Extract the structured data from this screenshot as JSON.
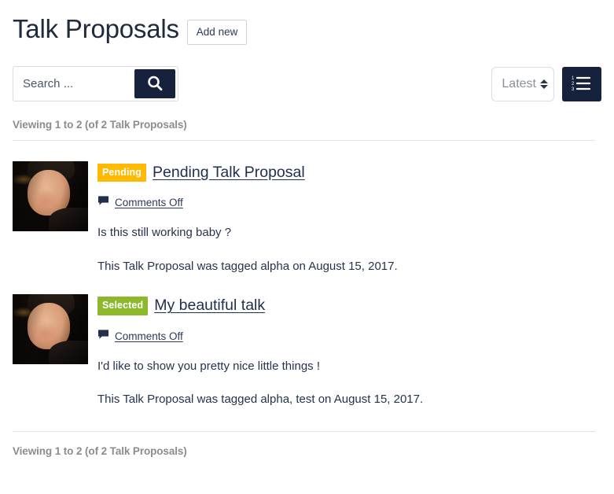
{
  "header": {
    "title": "Talk Proposals",
    "add_new_label": "Add new"
  },
  "toolbar": {
    "search_placeholder": "Search ...",
    "search_value": "",
    "search_icon": "search-icon",
    "sort_selected": "Latest",
    "sort_options": [
      "Latest"
    ],
    "list_view_icon": "ordered-list-icon"
  },
  "results": {
    "viewing_top": "Viewing 1 to 2 (of 2 Talk Proposals)",
    "viewing_bottom": "Viewing 1 to 2 (of 2 Talk Proposals)"
  },
  "colors": {
    "pending_badge": "#FFB900",
    "selected_badge": "#8CB82B",
    "button_dark": "#16213C",
    "text_dark": "#22304D",
    "muted": "#8C8C8C",
    "rule": "#E3E3E3"
  },
  "proposals": [
    {
      "avatar_name": "author-avatar",
      "status": "Pending",
      "status_color": "#FFB900",
      "title": "Pending Talk Proposal",
      "comments_icon": "comment-bubble-icon",
      "comments": "Comments Off",
      "excerpt": "Is this still working baby ?",
      "meta": "This Talk Proposal was tagged alpha on August 15, 2017."
    },
    {
      "avatar_name": "author-avatar",
      "status": "Selected",
      "status_color": "#8CB82B",
      "title": "My beautiful talk",
      "comments_icon": "comment-bubble-icon",
      "comments": "Comments Off",
      "excerpt": "I'd like to show you pretty nice little things !",
      "meta": "This Talk Proposal was tagged alpha, test on August 15, 2017."
    }
  ]
}
